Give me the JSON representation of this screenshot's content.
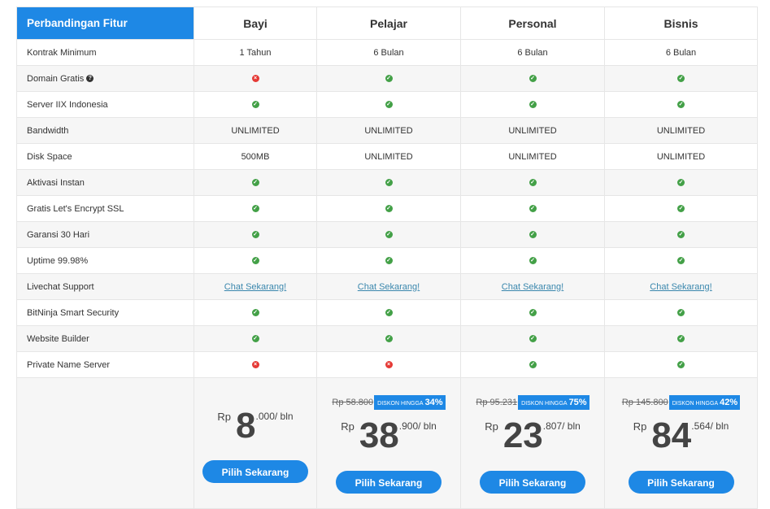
{
  "header": {
    "title": "Perbandingan Fitur",
    "plans": [
      "Bayi",
      "Pelajar",
      "Personal",
      "Bisnis"
    ]
  },
  "features": [
    {
      "label": "Kontrak Minimum",
      "help": false,
      "values": [
        {
          "t": "text",
          "v": "1 Tahun"
        },
        {
          "t": "text",
          "v": "6 Bulan"
        },
        {
          "t": "text",
          "v": "6 Bulan"
        },
        {
          "t": "text",
          "v": "6 Bulan"
        }
      ]
    },
    {
      "label": "Domain Gratis",
      "help": true,
      "values": [
        {
          "t": "no"
        },
        {
          "t": "yes"
        },
        {
          "t": "yes"
        },
        {
          "t": "yes"
        }
      ]
    },
    {
      "label": "Server IIX Indonesia",
      "help": false,
      "values": [
        {
          "t": "yes"
        },
        {
          "t": "yes"
        },
        {
          "t": "yes"
        },
        {
          "t": "yes"
        }
      ]
    },
    {
      "label": "Bandwidth",
      "help": false,
      "values": [
        {
          "t": "text",
          "v": "UNLIMITED"
        },
        {
          "t": "text",
          "v": "UNLIMITED"
        },
        {
          "t": "text",
          "v": "UNLIMITED"
        },
        {
          "t": "text",
          "v": "UNLIMITED"
        }
      ]
    },
    {
      "label": "Disk Space",
      "help": false,
      "values": [
        {
          "t": "text",
          "v": "500MB"
        },
        {
          "t": "text",
          "v": "UNLIMITED"
        },
        {
          "t": "text",
          "v": "UNLIMITED"
        },
        {
          "t": "text",
          "v": "UNLIMITED"
        }
      ]
    },
    {
      "label": "Aktivasi Instan",
      "help": false,
      "values": [
        {
          "t": "yes"
        },
        {
          "t": "yes"
        },
        {
          "t": "yes"
        },
        {
          "t": "yes"
        }
      ]
    },
    {
      "label": "Gratis Let's Encrypt SSL",
      "help": false,
      "values": [
        {
          "t": "yes"
        },
        {
          "t": "yes"
        },
        {
          "t": "yes"
        },
        {
          "t": "yes"
        }
      ]
    },
    {
      "label": "Garansi 30 Hari",
      "help": false,
      "values": [
        {
          "t": "yes"
        },
        {
          "t": "yes"
        },
        {
          "t": "yes"
        },
        {
          "t": "yes"
        }
      ]
    },
    {
      "label": "Uptime 99.98%",
      "help": false,
      "values": [
        {
          "t": "yes"
        },
        {
          "t": "yes"
        },
        {
          "t": "yes"
        },
        {
          "t": "yes"
        }
      ]
    },
    {
      "label": "Livechat Support",
      "help": false,
      "values": [
        {
          "t": "link",
          "v": "Chat Sekarang!"
        },
        {
          "t": "link",
          "v": "Chat Sekarang!"
        },
        {
          "t": "link",
          "v": "Chat Sekarang!"
        },
        {
          "t": "link",
          "v": "Chat Sekarang!"
        }
      ]
    },
    {
      "label": "BitNinja Smart Security",
      "help": false,
      "values": [
        {
          "t": "yes"
        },
        {
          "t": "yes"
        },
        {
          "t": "yes"
        },
        {
          "t": "yes"
        }
      ]
    },
    {
      "label": "Website Builder",
      "help": false,
      "values": [
        {
          "t": "yes"
        },
        {
          "t": "yes"
        },
        {
          "t": "yes"
        },
        {
          "t": "yes"
        }
      ]
    },
    {
      "label": "Private Name Server",
      "help": false,
      "values": [
        {
          "t": "no"
        },
        {
          "t": "no"
        },
        {
          "t": "yes"
        },
        {
          "t": "yes"
        }
      ]
    }
  ],
  "prices": [
    {
      "old": "",
      "discount_label": "",
      "discount_value": "",
      "currency": "Rp",
      "main": "8",
      "decimal": ".000",
      "period": "/ bln",
      "button": "Pilih Sekarang"
    },
    {
      "old": "Rp 58.800",
      "discount_label": "DISKON HINGGA",
      "discount_value": "34%",
      "currency": "Rp",
      "main": "38",
      "decimal": ".900",
      "period": "/ bln",
      "button": "Pilih Sekarang"
    },
    {
      "old": "Rp 95.231",
      "discount_label": "DISKON HINGGA",
      "discount_value": "75%",
      "currency": "Rp",
      "main": "23",
      "decimal": ".807",
      "period": "/ bln",
      "button": "Pilih Sekarang"
    },
    {
      "old": "Rp 145.800",
      "discount_label": "DISKON HINGGA",
      "discount_value": "42%",
      "currency": "Rp",
      "main": "84",
      "decimal": ".564",
      "period": "/ bln",
      "button": "Pilih Sekarang"
    }
  ],
  "colors": {
    "accent": "#1e88e5",
    "check": "#43a047",
    "cross": "#e53935",
    "link": "#3a87ad"
  },
  "icons": {
    "yes": "check-circle-icon",
    "no": "cross-circle-icon",
    "help": "question-circle-icon"
  }
}
